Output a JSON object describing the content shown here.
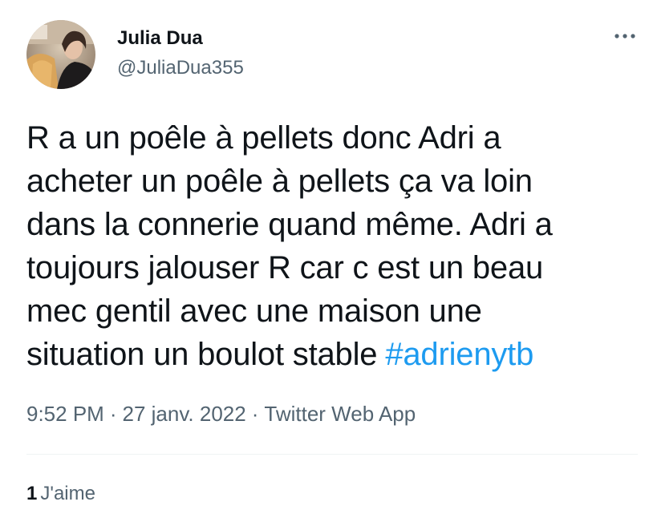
{
  "author": {
    "display_name": "Julia Dua",
    "handle": "@JuliaDua355"
  },
  "more_icon": "more-horizontal-icon",
  "tweet": {
    "lines": [
      "R a un poêle à pellets donc Adri a",
      "acheter un poêle à pellets ça va loin",
      "dans la connerie quand même. Adri a",
      "toujours jalouser R car c est un beau",
      "mec gentil avec une maison une",
      "situation un boulot stable"
    ],
    "hashtag": "#adrienytb"
  },
  "meta": {
    "time": "9:52 PM",
    "separator": "·",
    "date": "27 janv. 2022",
    "source": "Twitter Web App"
  },
  "stats": {
    "like_count": "1",
    "like_label": "J'aime"
  },
  "colors": {
    "text": "#0f1419",
    "secondary": "#536471",
    "accent": "#1d9bf0",
    "divider": "#eff3f4"
  }
}
